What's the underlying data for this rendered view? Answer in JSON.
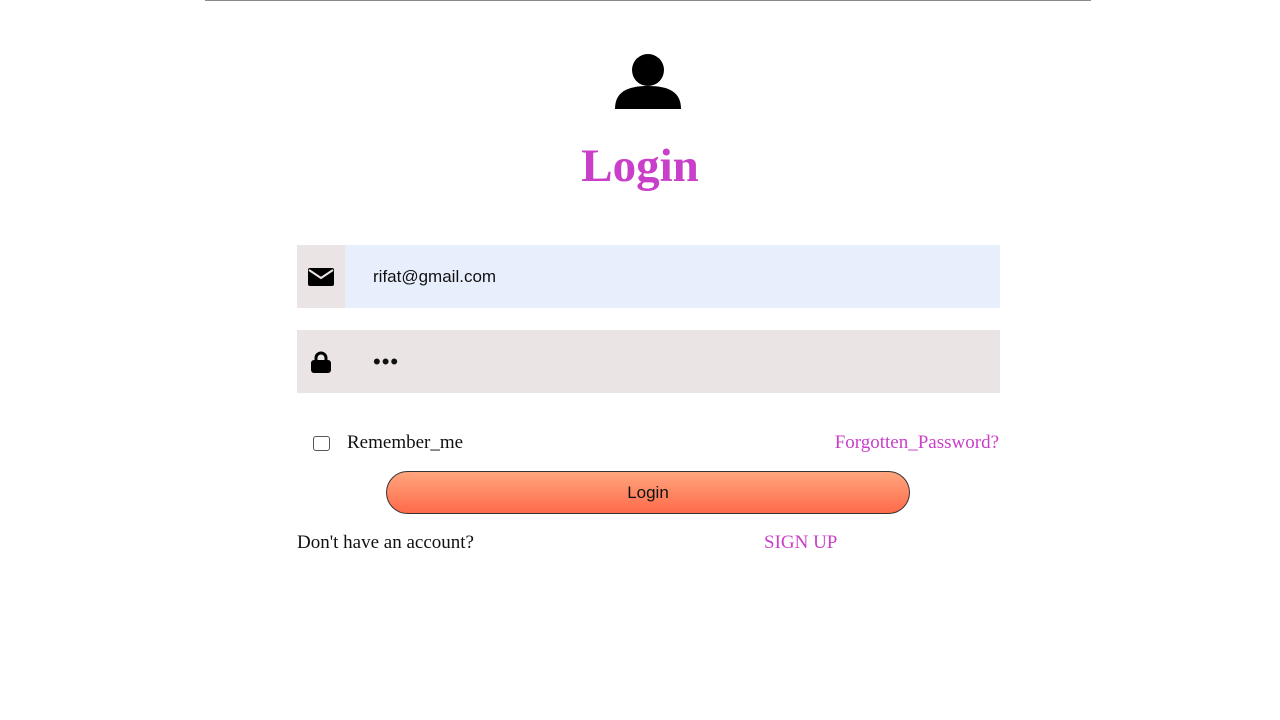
{
  "header": {
    "avatar_icon": "user-icon",
    "title": "Login"
  },
  "form": {
    "email": {
      "icon": "envelope-icon",
      "value": "rifat@gmail.com"
    },
    "password": {
      "icon": "lock-icon",
      "value": "•••"
    },
    "remember_label": "Remember_me",
    "remember_checked": false,
    "forgot_link": "Forgotten_Password?",
    "submit_label": "Login"
  },
  "footer": {
    "prompt": "Don't have an account?",
    "signup_link": "SIGN UP"
  },
  "colors": {
    "accent": "#c93fc9",
    "button_top": "#ffa67e",
    "button_bottom": "#ff6a4a",
    "field_bg": "#ebe4e4",
    "autofill_bg": "#e8effc"
  }
}
